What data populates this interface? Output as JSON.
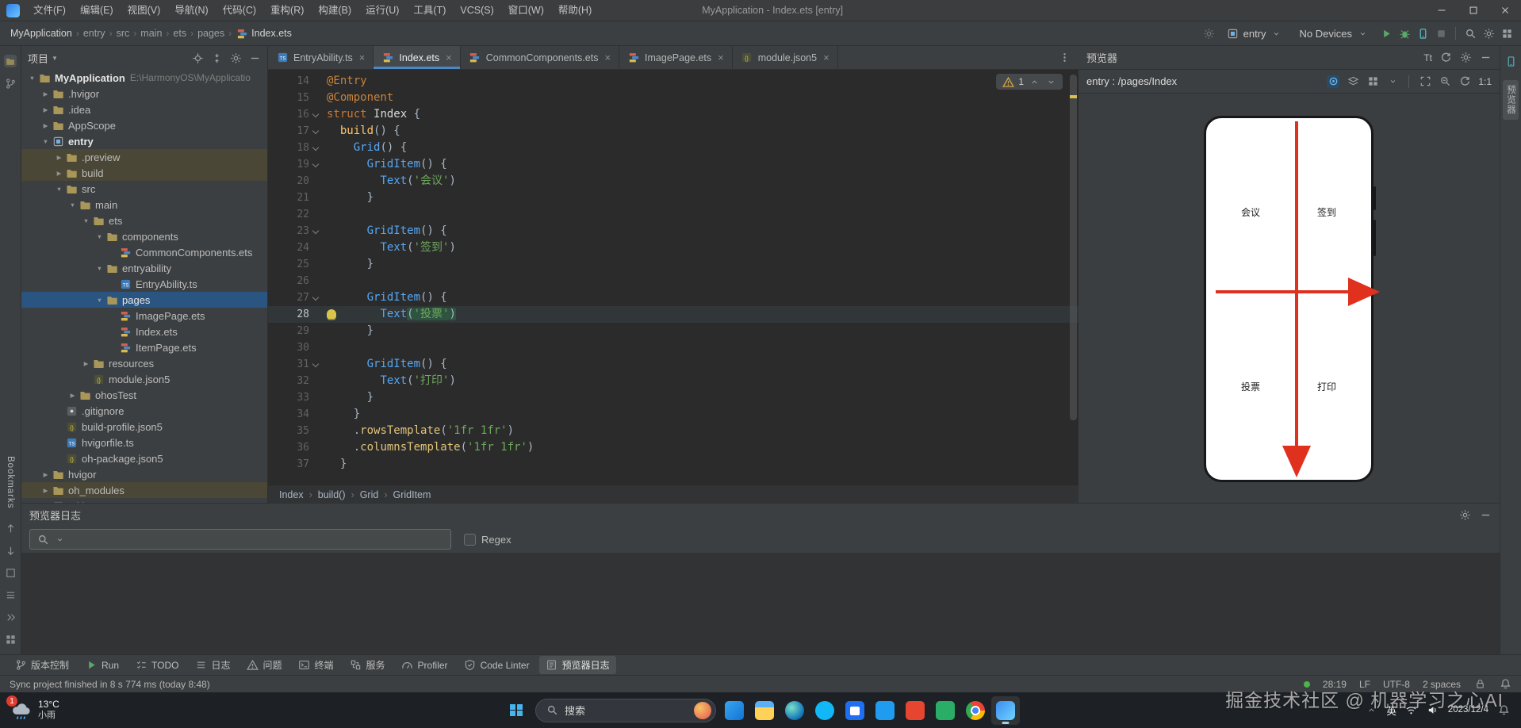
{
  "titlebar": {
    "menus": [
      "文件(F)",
      "编辑(E)",
      "视图(V)",
      "导航(N)",
      "代码(C)",
      "重构(R)",
      "构建(B)",
      "运行(U)",
      "工具(T)",
      "VCS(S)",
      "窗口(W)",
      "帮助(H)"
    ],
    "title": "MyApplication - Index.ets [entry]"
  },
  "toolbar": {
    "breadcrumbs": [
      "MyApplication",
      "entry",
      "src",
      "main",
      "ets",
      "pages",
      "Index.ets"
    ],
    "run_target": "entry",
    "device": "No Devices"
  },
  "left_stripe": {
    "bookmarks_label": "Bookmarks"
  },
  "project_panel": {
    "title": "项目",
    "tree": [
      {
        "label": "MyApplication",
        "path": "E:\\HarmonyOS\\MyApplicatio",
        "level": 0,
        "icon": "folder",
        "expanded": true,
        "bold": true
      },
      {
        "label": ".hvigor",
        "level": 1,
        "icon": "folder",
        "expanded": false
      },
      {
        "label": ".idea",
        "level": 1,
        "icon": "folder",
        "expanded": false
      },
      {
        "label": "AppScope",
        "level": 1,
        "icon": "folder",
        "expanded": false
      },
      {
        "label": "entry",
        "level": 1,
        "icon": "module",
        "expanded": true,
        "bold": true
      },
      {
        "label": ".preview",
        "level": 2,
        "icon": "folder",
        "expanded": false,
        "dim": true
      },
      {
        "label": "build",
        "level": 2,
        "icon": "folder",
        "expanded": false,
        "dim": true
      },
      {
        "label": "src",
        "level": 2,
        "icon": "folder",
        "expanded": true
      },
      {
        "label": "main",
        "level": 3,
        "icon": "folder",
        "expanded": true
      },
      {
        "label": "ets",
        "level": 4,
        "icon": "folder",
        "expanded": true
      },
      {
        "label": "components",
        "level": 5,
        "icon": "folder",
        "expanded": true
      },
      {
        "label": "CommonComponents.ets",
        "level": 6,
        "icon": "ets"
      },
      {
        "label": "entryability",
        "level": 5,
        "icon": "folder",
        "expanded": true
      },
      {
        "label": "EntryAbility.ts",
        "level": 6,
        "icon": "ts"
      },
      {
        "label": "pages",
        "level": 5,
        "icon": "folder",
        "expanded": true,
        "selected": true
      },
      {
        "label": "ImagePage.ets",
        "level": 6,
        "icon": "ets"
      },
      {
        "label": "Index.ets",
        "level": 6,
        "icon": "ets"
      },
      {
        "label": "ItemPage.ets",
        "level": 6,
        "icon": "ets"
      },
      {
        "label": "resources",
        "level": 4,
        "icon": "folder",
        "expanded": false
      },
      {
        "label": "module.json5",
        "level": 4,
        "icon": "json"
      },
      {
        "label": "ohosTest",
        "level": 3,
        "icon": "folder",
        "expanded": false
      },
      {
        "label": ".gitignore",
        "level": 2,
        "icon": "git"
      },
      {
        "label": "build-profile.json5",
        "level": 2,
        "icon": "json"
      },
      {
        "label": "hvigorfile.ts",
        "level": 2,
        "icon": "ts"
      },
      {
        "label": "oh-package.json5",
        "level": 2,
        "icon": "json"
      },
      {
        "label": "hvigor",
        "level": 1,
        "icon": "folder",
        "expanded": false
      },
      {
        "label": "oh_modules",
        "level": 1,
        "icon": "folder",
        "expanded": false,
        "dim": true
      },
      {
        "label": ".gitignore",
        "level": 1,
        "icon": "git"
      }
    ]
  },
  "editor": {
    "tabs": [
      {
        "label": "EntryAbility.ts",
        "icon": "ts"
      },
      {
        "label": "Index.ets",
        "icon": "ets",
        "active": true
      },
      {
        "label": "CommonComponents.ets",
        "icon": "ets"
      },
      {
        "label": "ImagePage.ets",
        "icon": "ets"
      },
      {
        "label": "module.json5",
        "icon": "json"
      }
    ],
    "inspection": {
      "warnings": "1"
    },
    "breadcrumb": [
      "Index",
      "build()",
      "Grid",
      "GridItem"
    ],
    "lines": [
      {
        "n": 14,
        "s": [
          [
            "ann",
            "@Entry"
          ]
        ]
      },
      {
        "n": 15,
        "s": [
          [
            "ann",
            "@Component"
          ]
        ]
      },
      {
        "n": 16,
        "f": 1,
        "s": [
          [
            "kw",
            "struct "
          ],
          [
            "cls",
            "Index"
          ],
          [
            "pl",
            " {"
          ]
        ]
      },
      {
        "n": 17,
        "f": 1,
        "s": [
          [
            "pl",
            "  "
          ],
          [
            "fn",
            "build"
          ],
          [
            "pl",
            "() {"
          ]
        ]
      },
      {
        "n": 18,
        "f": 1,
        "s": [
          [
            "pl",
            "    "
          ],
          [
            "comp",
            "Grid"
          ],
          [
            "pl",
            "() {"
          ]
        ]
      },
      {
        "n": 19,
        "f": 1,
        "s": [
          [
            "pl",
            "      "
          ],
          [
            "comp",
            "GridItem"
          ],
          [
            "pl",
            "() {"
          ]
        ]
      },
      {
        "n": 20,
        "s": [
          [
            "pl",
            "        "
          ],
          [
            "comp",
            "Text"
          ],
          [
            "pl",
            "("
          ],
          [
            "str",
            "'会议'"
          ],
          [
            "pl",
            ")"
          ]
        ]
      },
      {
        "n": 21,
        "s": [
          [
            "pl",
            "      }"
          ]
        ]
      },
      {
        "n": 22,
        "s": []
      },
      {
        "n": 23,
        "f": 1,
        "s": [
          [
            "pl",
            "      "
          ],
          [
            "comp",
            "GridItem"
          ],
          [
            "pl",
            "() {"
          ]
        ]
      },
      {
        "n": 24,
        "s": [
          [
            "pl",
            "        "
          ],
          [
            "comp",
            "Text"
          ],
          [
            "pl",
            "("
          ],
          [
            "str",
            "'签到'"
          ],
          [
            "pl",
            ")"
          ]
        ]
      },
      {
        "n": 25,
        "s": [
          [
            "pl",
            "      }"
          ]
        ]
      },
      {
        "n": 26,
        "s": []
      },
      {
        "n": 27,
        "f": 1,
        "s": [
          [
            "pl",
            "      "
          ],
          [
            "comp",
            "GridItem"
          ],
          [
            "pl",
            "() {"
          ]
        ]
      },
      {
        "n": 28,
        "c": 1,
        "b": 1,
        "s": [
          [
            "pl",
            "        "
          ],
          [
            "comp",
            "Text"
          ],
          [
            "pl",
            "(",
            1
          ],
          [
            "str",
            "'投票'",
            1
          ],
          [
            "pl",
            ")",
            1
          ]
        ]
      },
      {
        "n": 29,
        "s": [
          [
            "pl",
            "      }"
          ]
        ]
      },
      {
        "n": 30,
        "s": []
      },
      {
        "n": 31,
        "f": 1,
        "s": [
          [
            "pl",
            "      "
          ],
          [
            "comp",
            "GridItem"
          ],
          [
            "pl",
            "() {"
          ]
        ]
      },
      {
        "n": 32,
        "s": [
          [
            "pl",
            "        "
          ],
          [
            "comp",
            "Text"
          ],
          [
            "pl",
            "("
          ],
          [
            "str",
            "'打印'"
          ],
          [
            "pl",
            ")"
          ]
        ]
      },
      {
        "n": 33,
        "s": [
          [
            "pl",
            "      }"
          ]
        ]
      },
      {
        "n": 34,
        "s": [
          [
            "pl",
            "    }"
          ]
        ]
      },
      {
        "n": 35,
        "s": [
          [
            "pl",
            "    ."
          ],
          [
            "meth",
            "rowsTemplate"
          ],
          [
            "pl",
            "("
          ],
          [
            "str",
            "'1fr 1fr'"
          ],
          [
            "pl",
            ")"
          ]
        ]
      },
      {
        "n": 36,
        "s": [
          [
            "pl",
            "    ."
          ],
          [
            "meth",
            "columnsTemplate"
          ],
          [
            "pl",
            "("
          ],
          [
            "str",
            "'1fr 1fr'"
          ],
          [
            "pl",
            ")"
          ]
        ]
      },
      {
        "n": 37,
        "s": [
          [
            "pl",
            "  }"
          ]
        ]
      }
    ]
  },
  "previewer": {
    "title": "预览器",
    "tab_label": "预览器",
    "target": "entry : /pages/Index",
    "ratio": "1:1",
    "text_size_label": "Tt",
    "phone_labels": [
      "会议",
      "签到",
      "投票",
      "打印"
    ]
  },
  "log_panel": {
    "title": "预览器日志",
    "regex_label": "Regex"
  },
  "toolwindow_bar": {
    "items": [
      {
        "label": "版本控制",
        "icon": "branch"
      },
      {
        "label": "Run",
        "icon": "run"
      },
      {
        "label": "TODO",
        "icon": "todo"
      },
      {
        "label": "日志",
        "icon": "listlines"
      },
      {
        "label": "问题",
        "icon": "warngray"
      },
      {
        "label": "终端",
        "icon": "terminal"
      },
      {
        "label": "服务",
        "icon": "services"
      },
      {
        "label": "Profiler",
        "icon": "gauge"
      },
      {
        "label": "Code Linter",
        "icon": "lint"
      },
      {
        "label": "预览器日志",
        "icon": "prevlog",
        "active": true
      }
    ]
  },
  "statusbar": {
    "message": "Sync project finished in 8 s 774 ms (today 8:48)",
    "caret": "28:19",
    "line_sep": "LF",
    "encoding": "UTF-8",
    "indent": "2 spaces"
  },
  "taskbar": {
    "weather_temp": "13°C",
    "weather_desc": "小雨",
    "badge": "1",
    "search_label": "搜索",
    "apps": [
      {
        "name": "widgets"
      },
      {
        "name": "file-explorer"
      },
      {
        "name": "edge"
      },
      {
        "name": "qq"
      },
      {
        "name": "store"
      },
      {
        "name": "vscode"
      },
      {
        "name": "red-book"
      },
      {
        "name": "wechat"
      },
      {
        "name": "chrome"
      },
      {
        "name": "deveco-studio",
        "active": true
      }
    ],
    "lang": "英",
    "date": "2023/12/4"
  },
  "watermark": "掘金技术社区 @ 机器学习之心AI"
}
